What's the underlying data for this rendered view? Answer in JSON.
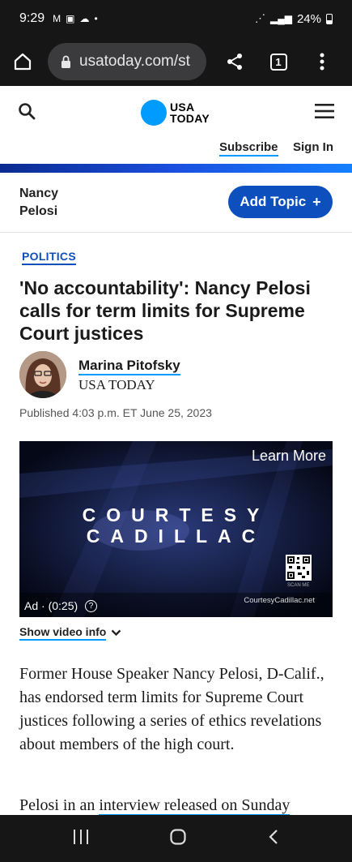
{
  "status": {
    "time": "9:29",
    "battery": "24%"
  },
  "browser": {
    "url": "usatoday.com/st",
    "tab_count": "1"
  },
  "site": {
    "logo_line1": "USA",
    "logo_line2": "TODAY",
    "subscribe": "Subscribe",
    "sign_in": "Sign In",
    "brand_color": "#009bff"
  },
  "topic": {
    "name": "Nancy Pelosi",
    "add_label": "Add Topic",
    "add_icon": "+"
  },
  "article": {
    "category": "POLITICS",
    "headline": "'No accountability': Nancy Pelosi calls for term limits for Supreme Court justices",
    "author": "Marina Pitofsky",
    "publication": "USA TODAY",
    "published": "Published 4:03 p.m. ET June 25, 2023",
    "paragraph1": "Former House Speaker Nancy Pelosi, D-Calif., has endorsed term limits for Supreme Court justices following a series of ethics revelations about members of the high court.",
    "paragraph2_start": "Pelosi in an ",
    "paragraph2_link": "interview released on Sunday"
  },
  "video": {
    "learn_more": "Learn More",
    "line1": "COURTESY",
    "line2": "CADILLAC",
    "qr_caption": "SCAN ME",
    "ad_label": "Ad · (0:25)",
    "ad_url": "CourtesyCadillac.net",
    "help": "?",
    "show_info": "Show video info"
  }
}
